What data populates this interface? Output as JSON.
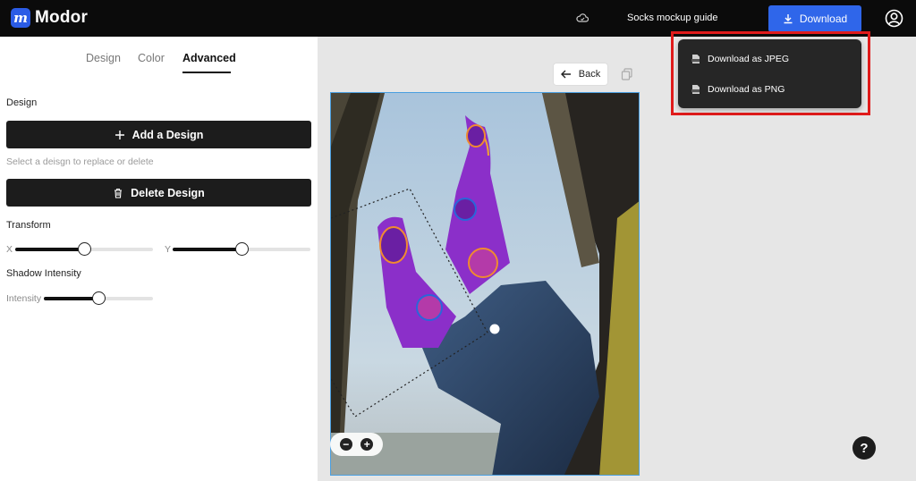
{
  "app": {
    "logo_letter": "m",
    "logo_text": "Modor"
  },
  "header": {
    "guide_label": "Socks mockup guide",
    "download_label": "Download",
    "accent_color": "#2f66ea"
  },
  "download_menu": {
    "items": [
      {
        "label": "Download as JPEG",
        "icon": "jpeg-file-icon"
      },
      {
        "label": "Download as PNG",
        "icon": "png-file-icon"
      }
    ],
    "highlight_color": "#e01b1b"
  },
  "tabs": [
    {
      "label": "Design",
      "active": false
    },
    {
      "label": "Color",
      "active": false
    },
    {
      "label": "Advanced",
      "active": true
    }
  ],
  "panel": {
    "design_section_label": "Design",
    "add_design_label": "Add a Design",
    "hint": "Select a deisgn to replace or delete",
    "delete_design_label": "Delete Design",
    "transform_label": "Transform",
    "x_label": "X",
    "y_label": "Y",
    "x_value": 0.5,
    "y_value": 0.5,
    "shadow_label": "Shadow Intensity",
    "intensity_label": "Intensity",
    "intensity_value": 0.5
  },
  "canvas": {
    "back_label": "Back",
    "zoom_out": "−",
    "zoom_in": "+"
  },
  "help": {
    "label": "?"
  }
}
